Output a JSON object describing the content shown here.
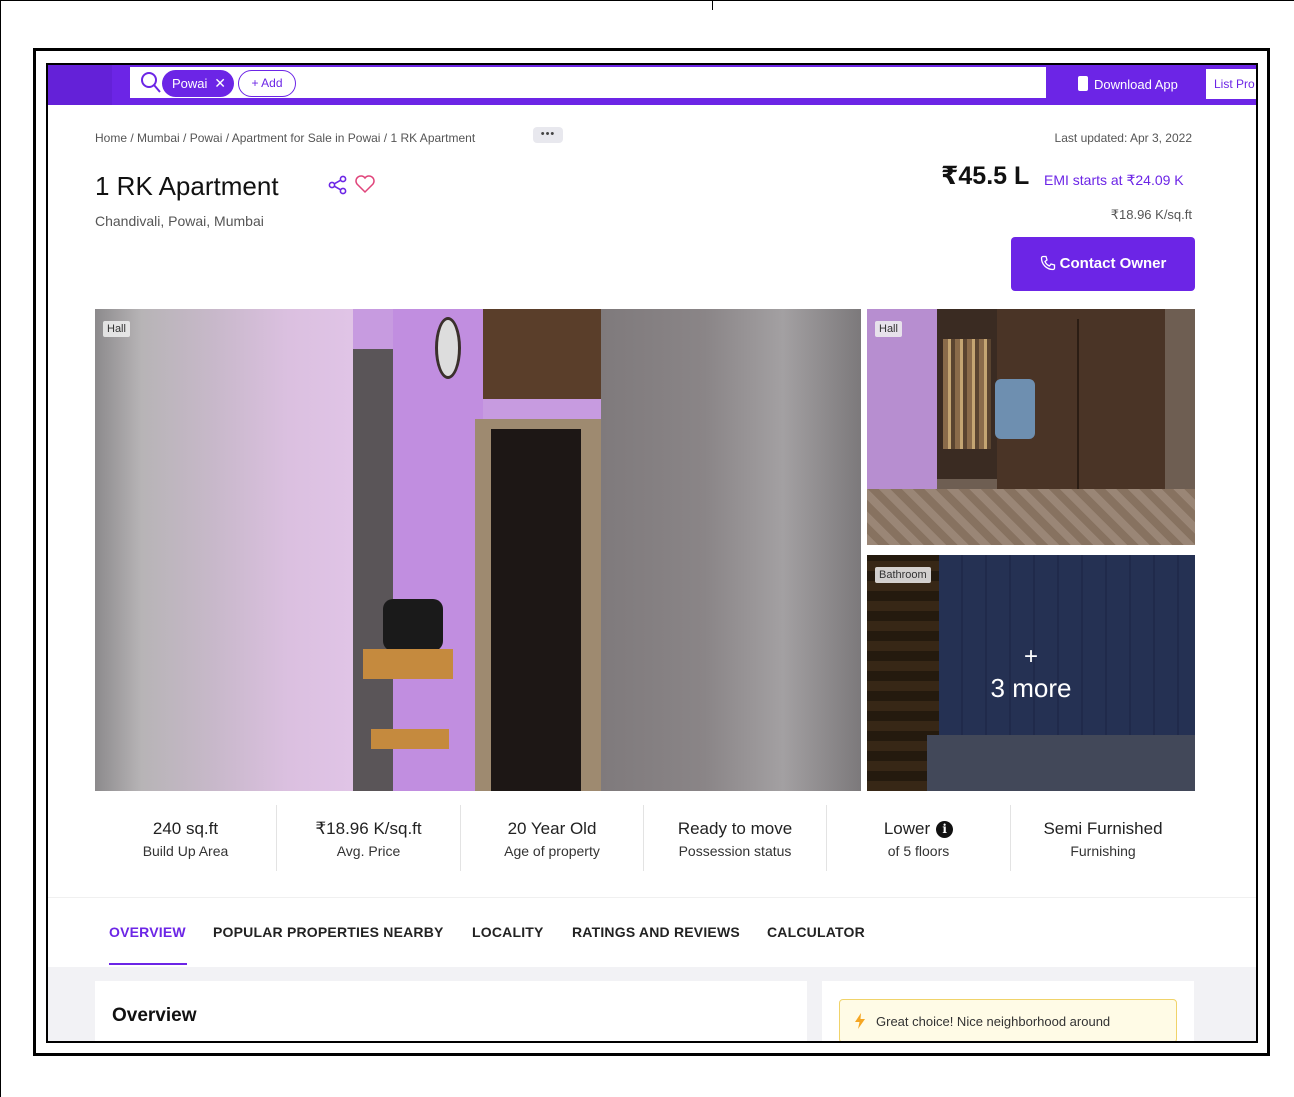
{
  "search": {
    "chip_label": "Powai",
    "add_label": "+ Add"
  },
  "header_actions": {
    "download_app": "Download App",
    "list_property": "List Pro"
  },
  "breadcrumb": {
    "text": "Home / Mumbai / Powai / Apartment for Sale in Powai / 1 RK Apartment",
    "more": "•••"
  },
  "listing": {
    "last_updated": "Last updated: Apr 3, 2022",
    "title": "1 RK Apartment",
    "locality": "Chandivali, Powai, Mumbai",
    "price": "₹45.5 L",
    "emi": "EMI starts at ₹24.09 K",
    "price_per_sqft": "₹18.96 K/sq.ft",
    "contact_button": "Contact Owner"
  },
  "gallery": {
    "main_tag": "Hall",
    "side1_tag": "Hall",
    "side2_tag": "Bathroom",
    "more_plus": "+",
    "more_label": "3 more"
  },
  "facts": [
    {
      "value": "240 sq.ft",
      "label": "Build Up Area"
    },
    {
      "value": "₹18.96 K/sq.ft",
      "label": "Avg. Price"
    },
    {
      "value": "20 Year Old",
      "label": "Age of property"
    },
    {
      "value": "Ready to move",
      "label": "Possession status"
    },
    {
      "value": "Lower",
      "label": "of 5 floors"
    },
    {
      "value": "Semi Furnished",
      "label": "Furnishing"
    }
  ],
  "tabs": [
    "OVERVIEW",
    "POPULAR PROPERTIES NEARBY",
    "LOCALITY",
    "RATINGS AND REVIEWS",
    "CALCULATOR"
  ],
  "overview": {
    "title": "Overview",
    "notice": "Great choice! Nice neighborhood around"
  },
  "colors": {
    "brand": "#6c25e6",
    "notice_bg": "#fffbe6"
  }
}
